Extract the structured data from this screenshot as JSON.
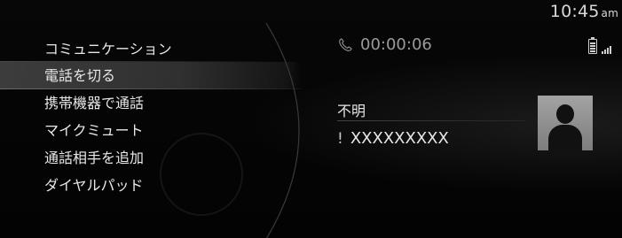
{
  "status_bar": {
    "time": "10:45",
    "ampm": "am"
  },
  "menu": {
    "title": "コミュニケーション",
    "items": [
      {
        "label": "電話を切る",
        "selected": true
      },
      {
        "label": "携帯機器で通話",
        "selected": false
      },
      {
        "label": "マイクミュート",
        "selected": false
      },
      {
        "label": "通話相手を追加",
        "selected": false
      },
      {
        "label": "ダイヤルパッド",
        "selected": false
      }
    ]
  },
  "call": {
    "duration": "00:00:06",
    "caller_name": "不明",
    "caller_number": "XXXXXXXXX",
    "icons": {
      "phone": "phone-handset-icon",
      "battery": "battery-icon",
      "signal": "signal-strength-icon",
      "number_type": "exclamation-icon",
      "avatar": "contact-avatar-icon"
    }
  },
  "colors": {
    "background": "#050505",
    "text": "#e6e6e6",
    "muted_text": "#9a9a9a",
    "selected_row": "#464646",
    "avatar_bg": "#8f8f8f"
  }
}
